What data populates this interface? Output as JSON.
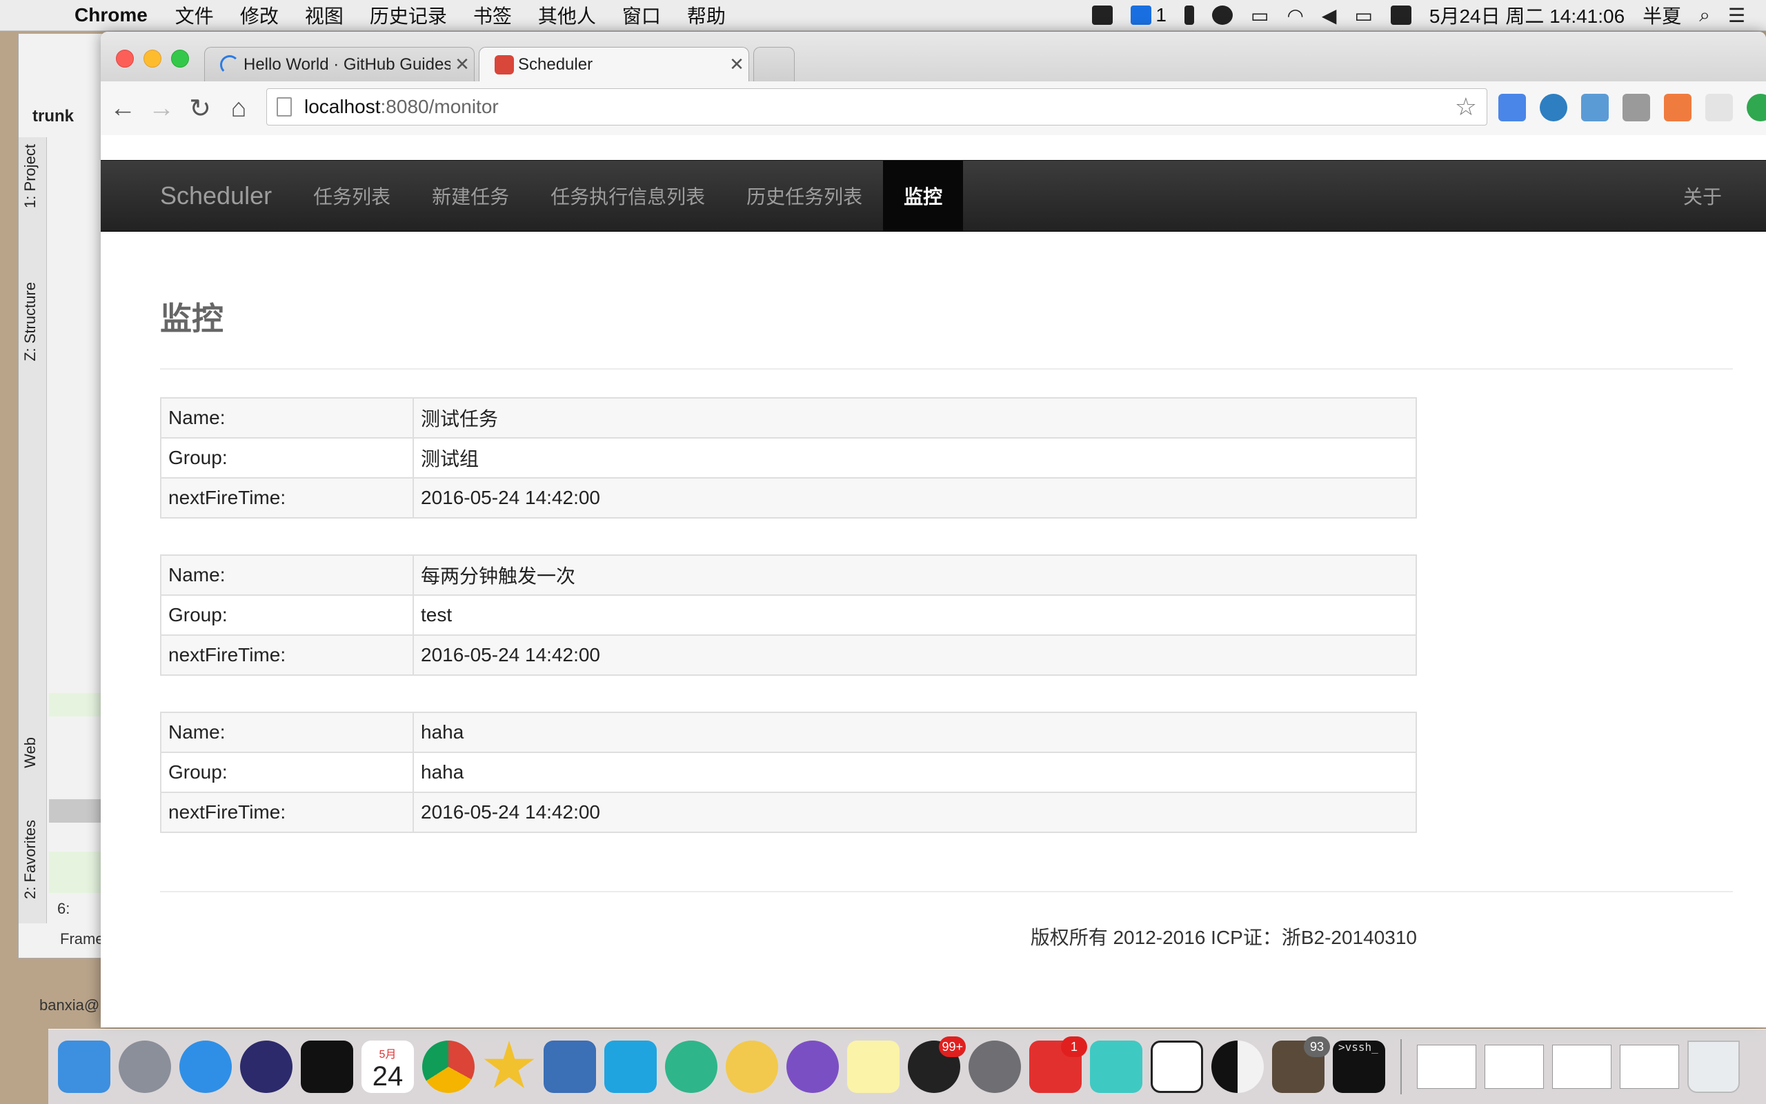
{
  "menubar": {
    "app_name": "Chrome",
    "menus": [
      "文件",
      "修改",
      "视图",
      "历史记录",
      "书签",
      "其他人",
      "窗口",
      "帮助"
    ],
    "status_count": "1",
    "datetime": "5月24日 周二  14:41:06",
    "user": "半夏"
  },
  "ide": {
    "project_label": "trunk",
    "vtabs": [
      "1: Project",
      "Z: Structure",
      "Web",
      "2: Favorites"
    ],
    "bottom_label": "Frame",
    "bottom_tab": "6:",
    "footer_user": "banxia@"
  },
  "browser": {
    "tabs": [
      {
        "title": "Hello World · GitHub Guides"
      },
      {
        "title": "Scheduler"
      }
    ],
    "url_host": "localhost",
    "url_path": ":8080/monitor"
  },
  "navbar": {
    "brand": "Scheduler",
    "links": [
      "任务列表",
      "新建任务",
      "任务执行信息列表",
      "历史任务列表",
      "监控"
    ],
    "about": "关于"
  },
  "page": {
    "title": "监控",
    "jobs": [
      {
        "name_label": "Name:",
        "name": "测试任务",
        "group_label": "Group:",
        "group": "测试组",
        "next_label": "nextFireTime:",
        "next": "2016-05-24 14:42:00"
      },
      {
        "name_label": "Name:",
        "name": "每两分钟触发一次",
        "group_label": "Group:",
        "group": "test",
        "next_label": "nextFireTime:",
        "next": "2016-05-24 14:42:00"
      },
      {
        "name_label": "Name:",
        "name": "haha",
        "group_label": "Group:",
        "group": "haha",
        "next_label": "nextFireTime:",
        "next": "2016-05-24 14:42:00"
      }
    ],
    "footer": "版权所有 2012-2016 ICP证：浙B2-20140310"
  },
  "dock": {
    "calendar_month": "5月",
    "calendar_day": "24",
    "qq_badge": "99+",
    "g_badge": "1",
    "pkg_badge": "93",
    "terminal_text": ">vssh_"
  },
  "colors": {
    "navbar_bg": "#222222",
    "navbar_active": "#080808",
    "table_border": "#dedede",
    "table_stripe": "#f7f7f7"
  }
}
